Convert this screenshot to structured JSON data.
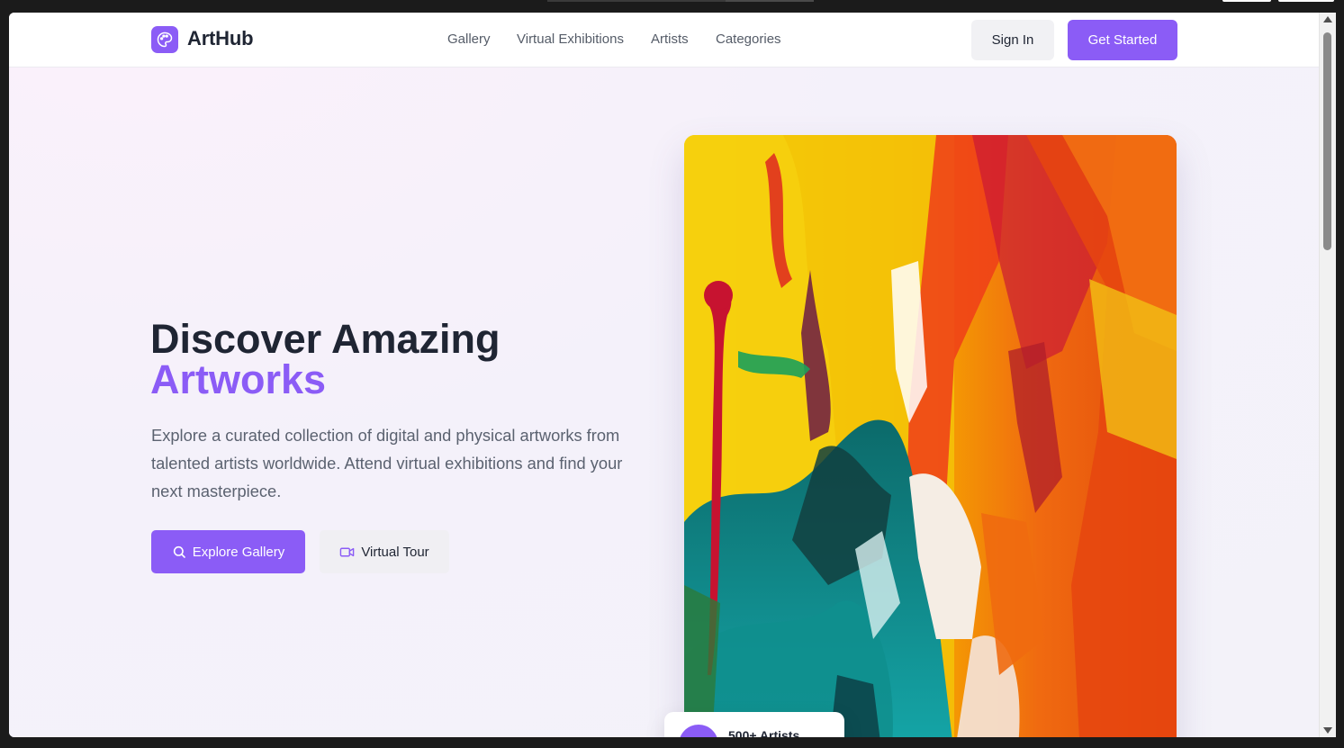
{
  "brand": {
    "name": "ArtHub",
    "logo_icon": "palette-icon",
    "accent_color": "#8b5cf6"
  },
  "nav": {
    "links": [
      "Gallery",
      "Virtual Exhibitions",
      "Artists",
      "Categories"
    ],
    "sign_in": "Sign In",
    "get_started": "Get Started"
  },
  "hero": {
    "title_line1": "Discover Amazing",
    "title_line2": "Artworks",
    "description": "Explore a curated collection of digital and physical artworks from talented artists worldwide. Attend virtual exhibitions and find your next masterpiece.",
    "primary_button": {
      "label": "Explore Gallery",
      "icon": "search-icon"
    },
    "secondary_button": {
      "label": "Virtual Tour",
      "icon": "video-icon"
    }
  },
  "featured_image": {
    "subject": "abstract painting"
  },
  "stat_card": {
    "label": "500+ Artists"
  }
}
